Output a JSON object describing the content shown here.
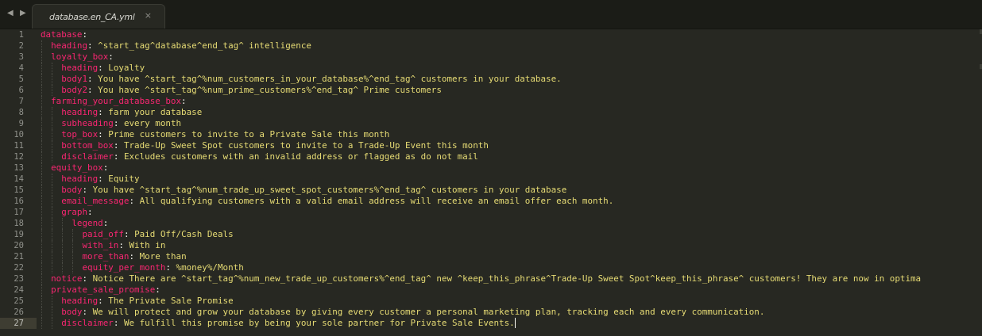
{
  "tabstrip": {
    "back_glyph": "◀",
    "forward_glyph": "▶",
    "tab": {
      "title": "database.en_CA.yml",
      "close_glyph": "×"
    }
  },
  "editor": {
    "active_line": 27,
    "colors": {
      "background": "#272822",
      "key": "#f92672",
      "value": "#e6db74",
      "punctuation": "#f8f8f2",
      "line_number": "#8f908a"
    },
    "lines": [
      {
        "n": "1",
        "indent": "",
        "key": "database",
        "value": ""
      },
      {
        "n": "2",
        "indent": "  ",
        "key": "heading",
        "value": "^start_tag^database^end_tag^ intelligence"
      },
      {
        "n": "3",
        "indent": "  ",
        "key": "loyalty_box",
        "value": ""
      },
      {
        "n": "4",
        "indent": "    ",
        "key": "heading",
        "value": "Loyalty"
      },
      {
        "n": "5",
        "indent": "    ",
        "key": "body1",
        "value": "You have ^start_tag^%num_customers_in_your_database%^end_tag^ customers in your database."
      },
      {
        "n": "6",
        "indent": "    ",
        "key": "body2",
        "value": "You have ^start_tag^%num_prime_customers%^end_tag^ Prime customers"
      },
      {
        "n": "7",
        "indent": "  ",
        "key": "farming_your_database_box",
        "value": ""
      },
      {
        "n": "8",
        "indent": "    ",
        "key": "heading",
        "value": "farm your database"
      },
      {
        "n": "9",
        "indent": "    ",
        "key": "subheading",
        "value": "every month"
      },
      {
        "n": "10",
        "indent": "    ",
        "key": "top_box",
        "value": "Prime customers to invite to a Private Sale this month"
      },
      {
        "n": "11",
        "indent": "    ",
        "key": "bottom_box",
        "value": "Trade-Up Sweet Spot customers to invite to a Trade-Up Event this month"
      },
      {
        "n": "12",
        "indent": "    ",
        "key": "disclaimer",
        "value": "Excludes customers with an invalid address or flagged as do not mail"
      },
      {
        "n": "13",
        "indent": "  ",
        "key": "equity_box",
        "value": ""
      },
      {
        "n": "14",
        "indent": "    ",
        "key": "heading",
        "value": "Equity"
      },
      {
        "n": "15",
        "indent": "    ",
        "key": "body",
        "value": "You have ^start_tag^%num_trade_up_sweet_spot_customers%^end_tag^ customers in your database"
      },
      {
        "n": "16",
        "indent": "    ",
        "key": "email_message",
        "value": "All qualifying customers with a valid email address will receive an email offer each month."
      },
      {
        "n": "17",
        "indent": "    ",
        "key": "graph",
        "value": ""
      },
      {
        "n": "18",
        "indent": "      ",
        "key": "legend",
        "value": ""
      },
      {
        "n": "19",
        "indent": "        ",
        "key": "paid_off",
        "value": "Paid Off/Cash Deals"
      },
      {
        "n": "20",
        "indent": "        ",
        "key": "with_in",
        "value": "With in"
      },
      {
        "n": "21",
        "indent": "        ",
        "key": "more_than",
        "value": "More than"
      },
      {
        "n": "22",
        "indent": "        ",
        "key": "equity_per_month",
        "value": "%money%/Month"
      },
      {
        "n": "23",
        "indent": "  ",
        "key": "notice",
        "value": "Notice There are ^start_tag^%num_new_trade_up_customers%^end_tag^ new ^keep_this_phrase^Trade-Up Sweet Spot^keep_this_phrase^ customers! They are now in optima"
      },
      {
        "n": "24",
        "indent": "  ",
        "key": "private_sale_promise",
        "value": ""
      },
      {
        "n": "25",
        "indent": "    ",
        "key": "heading",
        "value": "The Private Sale Promise"
      },
      {
        "n": "26",
        "indent": "    ",
        "key": "body",
        "value": "We will protect and grow your database by giving every customer a personal marketing plan, tracking each and every communication."
      },
      {
        "n": "27",
        "indent": "    ",
        "key": "disclaimer",
        "value": "We fulfill this promise by being your sole partner for Private Sale Events."
      }
    ]
  }
}
